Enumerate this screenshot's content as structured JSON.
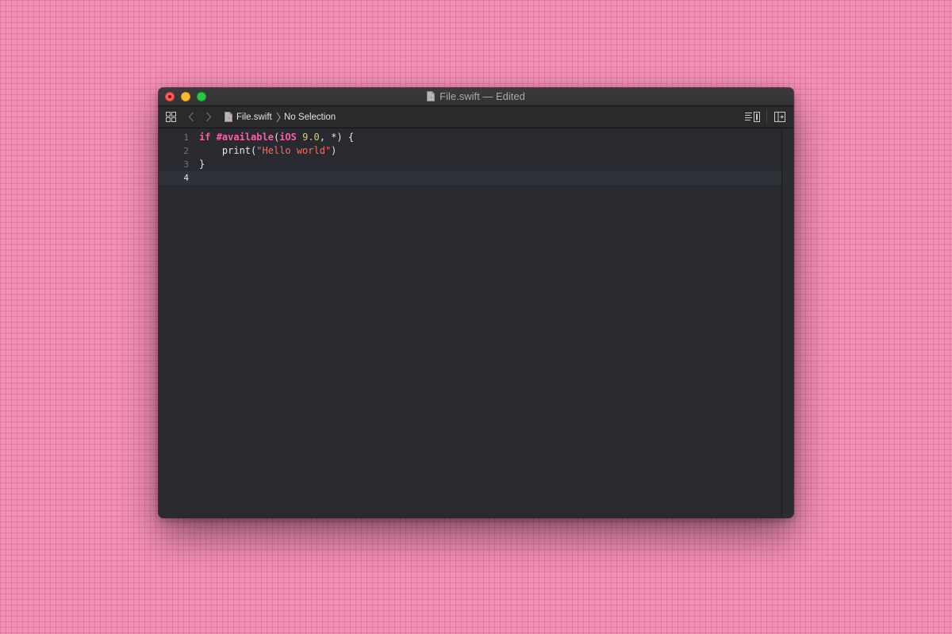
{
  "window": {
    "title": "File.swift — Edited"
  },
  "toolbar": {
    "related_items_icon": "grid-icon",
    "back_icon": "chevron-left-icon",
    "forward_icon": "chevron-right-icon",
    "breadcrumb": {
      "file_name": "File.swift",
      "separator": "〉",
      "selection": "No Selection"
    },
    "editor_options_icon": "lines-panel-icon",
    "add_editor_icon": "split-add-icon"
  },
  "editor": {
    "current_line": 4,
    "lines": [
      {
        "number": "1",
        "tokens": [
          {
            "text": "if",
            "kind": "keyword"
          },
          {
            "text": " ",
            "kind": "plain"
          },
          {
            "text": "#available",
            "kind": "keyword"
          },
          {
            "text": "(",
            "kind": "plain"
          },
          {
            "text": "iOS",
            "kind": "keyword"
          },
          {
            "text": " ",
            "kind": "plain"
          },
          {
            "text": "9.0",
            "kind": "number"
          },
          {
            "text": ", *) {",
            "kind": "plain"
          }
        ]
      },
      {
        "number": "2",
        "tokens": [
          {
            "text": "    print(",
            "kind": "plain"
          },
          {
            "text": "\"Hello world\"",
            "kind": "string"
          },
          {
            "text": ")",
            "kind": "plain"
          }
        ]
      },
      {
        "number": "3",
        "tokens": [
          {
            "text": "}",
            "kind": "plain"
          }
        ]
      },
      {
        "number": "4",
        "tokens": []
      }
    ]
  },
  "colors": {
    "desktop_background": "#f48fb6",
    "editor_background": "#292a2f",
    "keyword": "#fc5fa3",
    "number": "#d9c97c",
    "string": "#fc6a5d",
    "plain_text": "#e6e6e8",
    "line_number": "#74757b"
  }
}
